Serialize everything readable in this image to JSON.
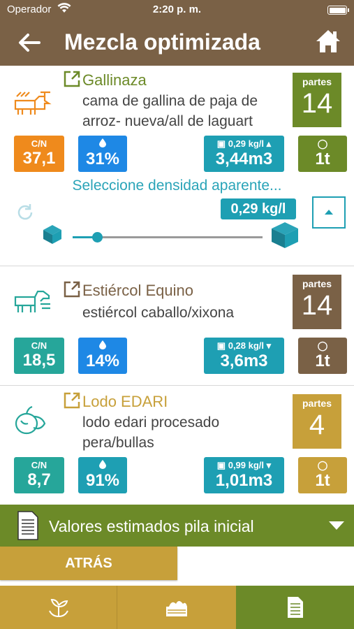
{
  "status": {
    "carrier": "Operador",
    "time": "2:20 p. m."
  },
  "header": {
    "title": "Mezcla optimizada",
    "back_icon": "arrow-left-icon",
    "home_icon": "home-icon"
  },
  "colors": {
    "brown": "#7a6146",
    "green": "#6c8a28",
    "teal": "#1e9fb3",
    "orange": "#ef8a1c",
    "gold": "#c7a03a"
  },
  "materials": [
    {
      "name": "Gallinaza",
      "desc_line1": "cama de gallina de paja de",
      "desc_line2": "arroz- nueva/all de laguart",
      "parts_label": "partes",
      "parts": "14",
      "cn_label": "C/N",
      "cn": "37,1",
      "humidity": "31%",
      "density": "0,29 kg/l",
      "volume": "3,44m3",
      "weight": "1t",
      "select_density": "Seleccione densidad aparente...",
      "slider_value": "0,29 kg/l",
      "slider_level": 0.13
    },
    {
      "name": "Estiércol Equino",
      "desc_line1": "estiércol caballo/xixona",
      "parts_label": "partes",
      "parts": "14",
      "cn_label": "C/N",
      "cn": "18,5",
      "humidity": "14%",
      "density": "0,28 kg/l",
      "volume": "3,6m3",
      "weight": "1t"
    },
    {
      "name": "Lodo EDARI",
      "desc_line1": "lodo edari procesado",
      "desc_line2": "pera/bullas",
      "parts_label": "partes",
      "parts": "4",
      "cn_label": "C/N",
      "cn": "8,7",
      "humidity": "91%",
      "density": "0,99 kg/l",
      "volume": "1,01m3",
      "weight": "1t"
    }
  ],
  "estimados": {
    "label": "Valores estimados pila inicial"
  },
  "atras": {
    "label": "ATRÁS"
  },
  "tabs": [
    {
      "icon": "plant-hands-icon"
    },
    {
      "icon": "compost-pile-icon"
    },
    {
      "icon": "document-icon"
    }
  ]
}
